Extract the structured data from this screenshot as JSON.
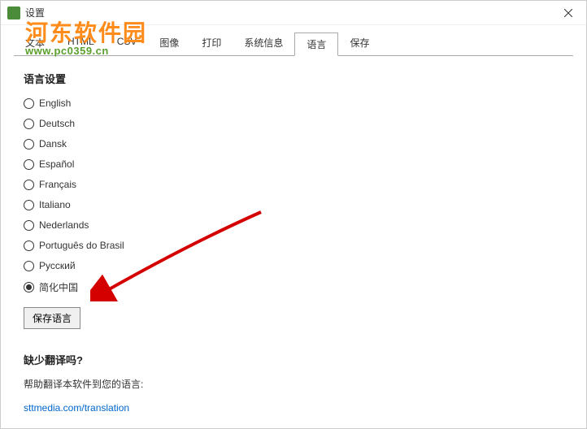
{
  "window": {
    "title": "设置"
  },
  "tabs": {
    "items": [
      {
        "label": "文本"
      },
      {
        "label": "HTML"
      },
      {
        "label": "CSV"
      },
      {
        "label": "图像"
      },
      {
        "label": "打印"
      },
      {
        "label": "系统信息"
      },
      {
        "label": "语言"
      },
      {
        "label": "保存"
      }
    ],
    "activeIndex": 6
  },
  "language": {
    "sectionTitle": "语言设置",
    "options": [
      {
        "label": "English",
        "checked": false
      },
      {
        "label": "Deutsch",
        "checked": false
      },
      {
        "label": "Dansk",
        "checked": false
      },
      {
        "label": "Español",
        "checked": false
      },
      {
        "label": "Français",
        "checked": false
      },
      {
        "label": "Italiano",
        "checked": false
      },
      {
        "label": "Nederlands",
        "checked": false
      },
      {
        "label": "Português do Brasil",
        "checked": false
      },
      {
        "label": "Русский",
        "checked": false
      },
      {
        "label": "简化中国",
        "checked": true
      }
    ],
    "saveButton": "保存语言"
  },
  "missing": {
    "title": "缺少翻译吗?",
    "text": "帮助翻译本软件到您的语言:",
    "link": "sttmedia.com/translation"
  },
  "watermark": {
    "main": "河东软件园",
    "url": "www.pc0359.cn"
  }
}
